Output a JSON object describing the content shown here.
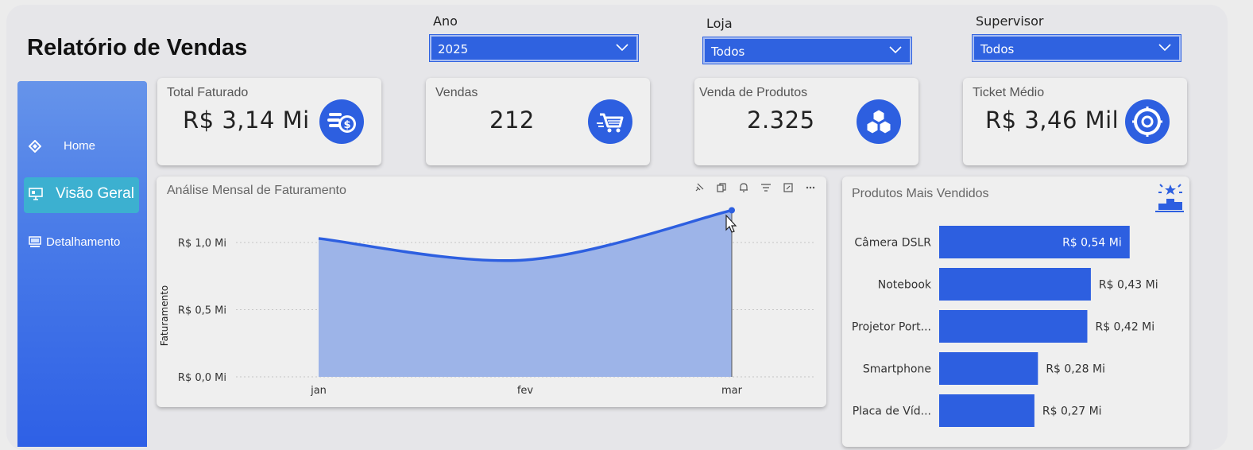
{
  "header": {
    "title": "Relatório de Vendas"
  },
  "filters": [
    {
      "label": "Ano",
      "value": "2025"
    },
    {
      "label": "Loja",
      "value": "Todos"
    },
    {
      "label": "Supervisor",
      "value": "Todos"
    }
  ],
  "sidebar": {
    "items": [
      {
        "label": "Home",
        "icon": "home-icon"
      },
      {
        "label": "Visão Geral",
        "icon": "monitor-icon",
        "active": true
      },
      {
        "label": "Detalhamento",
        "icon": "computer-icon"
      }
    ]
  },
  "kpis": [
    {
      "label": "Total Faturado",
      "value": "R$ 3,14 Mi",
      "icon": "coins-icon"
    },
    {
      "label": "Vendas",
      "value": "212",
      "icon": "cart-icon"
    },
    {
      "label": "Venda de Produtos",
      "value": "2.325",
      "icon": "boxes-icon"
    },
    {
      "label": "Ticket Médio",
      "value": "R$ 3,46 Mil",
      "icon": "target-icon"
    }
  ],
  "colors": {
    "accent": "#2d5fe0",
    "area_fill": "#9db4e8",
    "active_nav": "#3cb0d0"
  },
  "monthly_chart": {
    "title": "Análise Mensal de Faturamento",
    "ylabel": "Faturamento",
    "y_ticks": [
      "R$ 0,0 Mi",
      "R$ 0,5 Mi",
      "R$ 1,0 Mi"
    ],
    "toolbar_icons": [
      "pin-icon",
      "copy-icon",
      "bell-icon",
      "filter-icon",
      "focus-icon",
      "more-icon"
    ]
  },
  "top_products": {
    "title": "Produtos Mais Vendidos",
    "icon": "podium-icon"
  },
  "chart_data": [
    {
      "type": "area",
      "title": "Análise Mensal de Faturamento",
      "ylabel": "Faturamento",
      "categories": [
        "jan",
        "fev",
        "mar"
      ],
      "values": [
        1.03,
        0.87,
        1.24
      ],
      "unit": "R$ Mi",
      "ylim": [
        0,
        1.24
      ],
      "grid": true
    },
    {
      "type": "bar",
      "orientation": "horizontal",
      "title": "Produtos Mais Vendidos",
      "categories": [
        "Câmera DSLR",
        "Notebook",
        "Projetor Port...",
        "Smartphone",
        "Placa de Víd..."
      ],
      "values": [
        0.54,
        0.43,
        0.42,
        0.28,
        0.27
      ],
      "labels": [
        "R$ 0,54 Mi",
        "R$ 0,43 Mi",
        "R$ 0,42 Mi",
        "R$ 0,28 Mi",
        "R$ 0,27 Mi"
      ],
      "unit": "R$ Mi"
    }
  ]
}
